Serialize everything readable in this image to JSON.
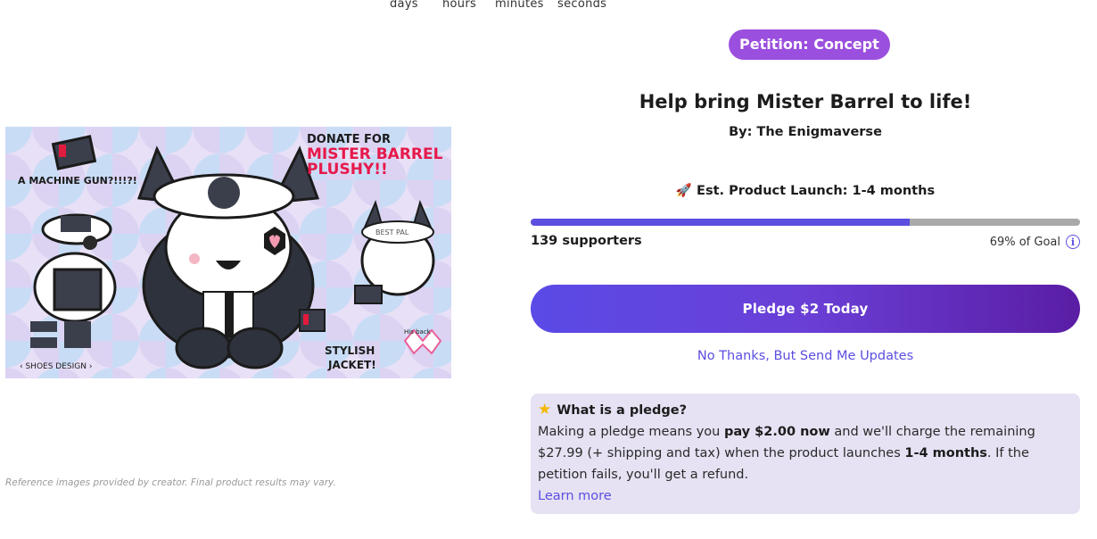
{
  "countdown": {
    "days": "days",
    "hours": "hours",
    "minutes": "minutes",
    "seconds": "seconds"
  },
  "media": {
    "alt_texts": {
      "donate": "DONATE FOR",
      "name": "MISTER BARREL",
      "plushy": "PLUSHY!!",
      "machine_gun": "A MACHINE GUN?!!!?!",
      "shoes": "‹ SHOES DESIGN ›",
      "jacket_1": "STYLISH",
      "jacket_2": "JACKET!",
      "best_pal": "BEST PAL",
      "his_back": "His back"
    },
    "disclaimer": "Reference images provided by creator. Final product results may vary."
  },
  "badge": "Petition: Concept",
  "title": "Help bring Mister Barrel to life!",
  "byline": "By: The Enigmaverse",
  "launch": {
    "icon": "rocket-icon",
    "label": "Est. Product Launch:",
    "value": "1-4 months"
  },
  "progress": {
    "fraction": 0.69,
    "color": "#5b4ee0"
  },
  "supporters": "139 supporters",
  "goal": "69% of Goal",
  "pledge_button": "Pledge $2 Today",
  "no_thanks": "No Thanks, But Send Me Updates",
  "pledge_info": {
    "icon": "star-icon",
    "heading": "What is a pledge?",
    "body_1": "Making a pledge means you ",
    "body_pay": "pay $2.00 now",
    "body_2": " and we'll charge the remaining $27.99 (+ shipping and tax) when the product launches ",
    "body_months": "1-4 months",
    "body_3": ". If the petition fails, you'll get a refund.",
    "learn_more": "Learn more"
  },
  "colors": {
    "accent": "#5b4ee0",
    "badge": "#9b4fde",
    "info_bg": "#e6e2f3"
  }
}
